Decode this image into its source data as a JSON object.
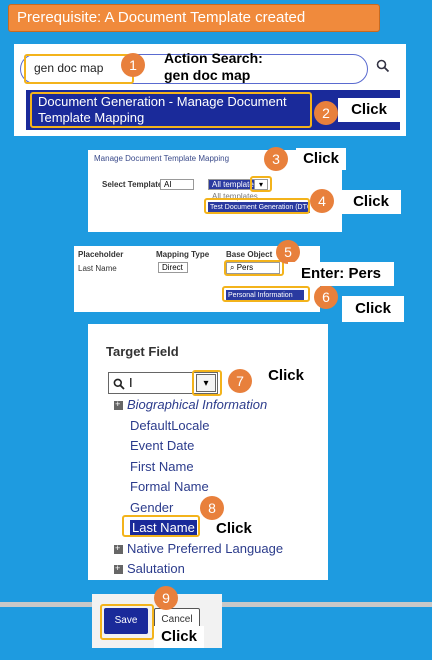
{
  "banner": {
    "title": "Prerequisite: A Document Template created"
  },
  "step1": {
    "search_value": "gen doc map",
    "search_icon": "search-icon",
    "action_label_line1": "Action Search:",
    "action_label_line2": "gen doc map",
    "result_line1": "Document Generation - Manage Document",
    "result_line2": "Template Mapping",
    "click_label": "Click"
  },
  "step3": {
    "page_title": "Manage Document Template Mapping",
    "select_label": "Select Template",
    "lang_value": "AI",
    "template_value": "All template",
    "option_all": "All templates",
    "option_test": "Test Document Generation (DTG1)",
    "click_label": "Click"
  },
  "step5": {
    "col_placeholder": "Placeholder",
    "col_mapping": "Mapping Type",
    "col_base": "Base Object",
    "row_placeholder": "Last Name",
    "row_mapping": "Direct",
    "search_value": "Pers",
    "option_personal": "Personal Information",
    "enter_label": "Enter: Pers",
    "click_label": "Click"
  },
  "step7": {
    "title": "Target Field",
    "input_value": "I",
    "click_label": "Click",
    "items": [
      "Biographical Information",
      "DefaultLocale",
      "Event Date",
      "First Name",
      "Formal Name",
      "Gender",
      "Last Name",
      "Native Preferred Language",
      "Salutation"
    ],
    "click8_label": "Click"
  },
  "step9": {
    "save_label": "Save",
    "cancel_label": "Cancel",
    "click_label": "Click"
  },
  "badges": [
    "1",
    "2",
    "3",
    "4",
    "5",
    "6",
    "7",
    "8",
    "9"
  ]
}
